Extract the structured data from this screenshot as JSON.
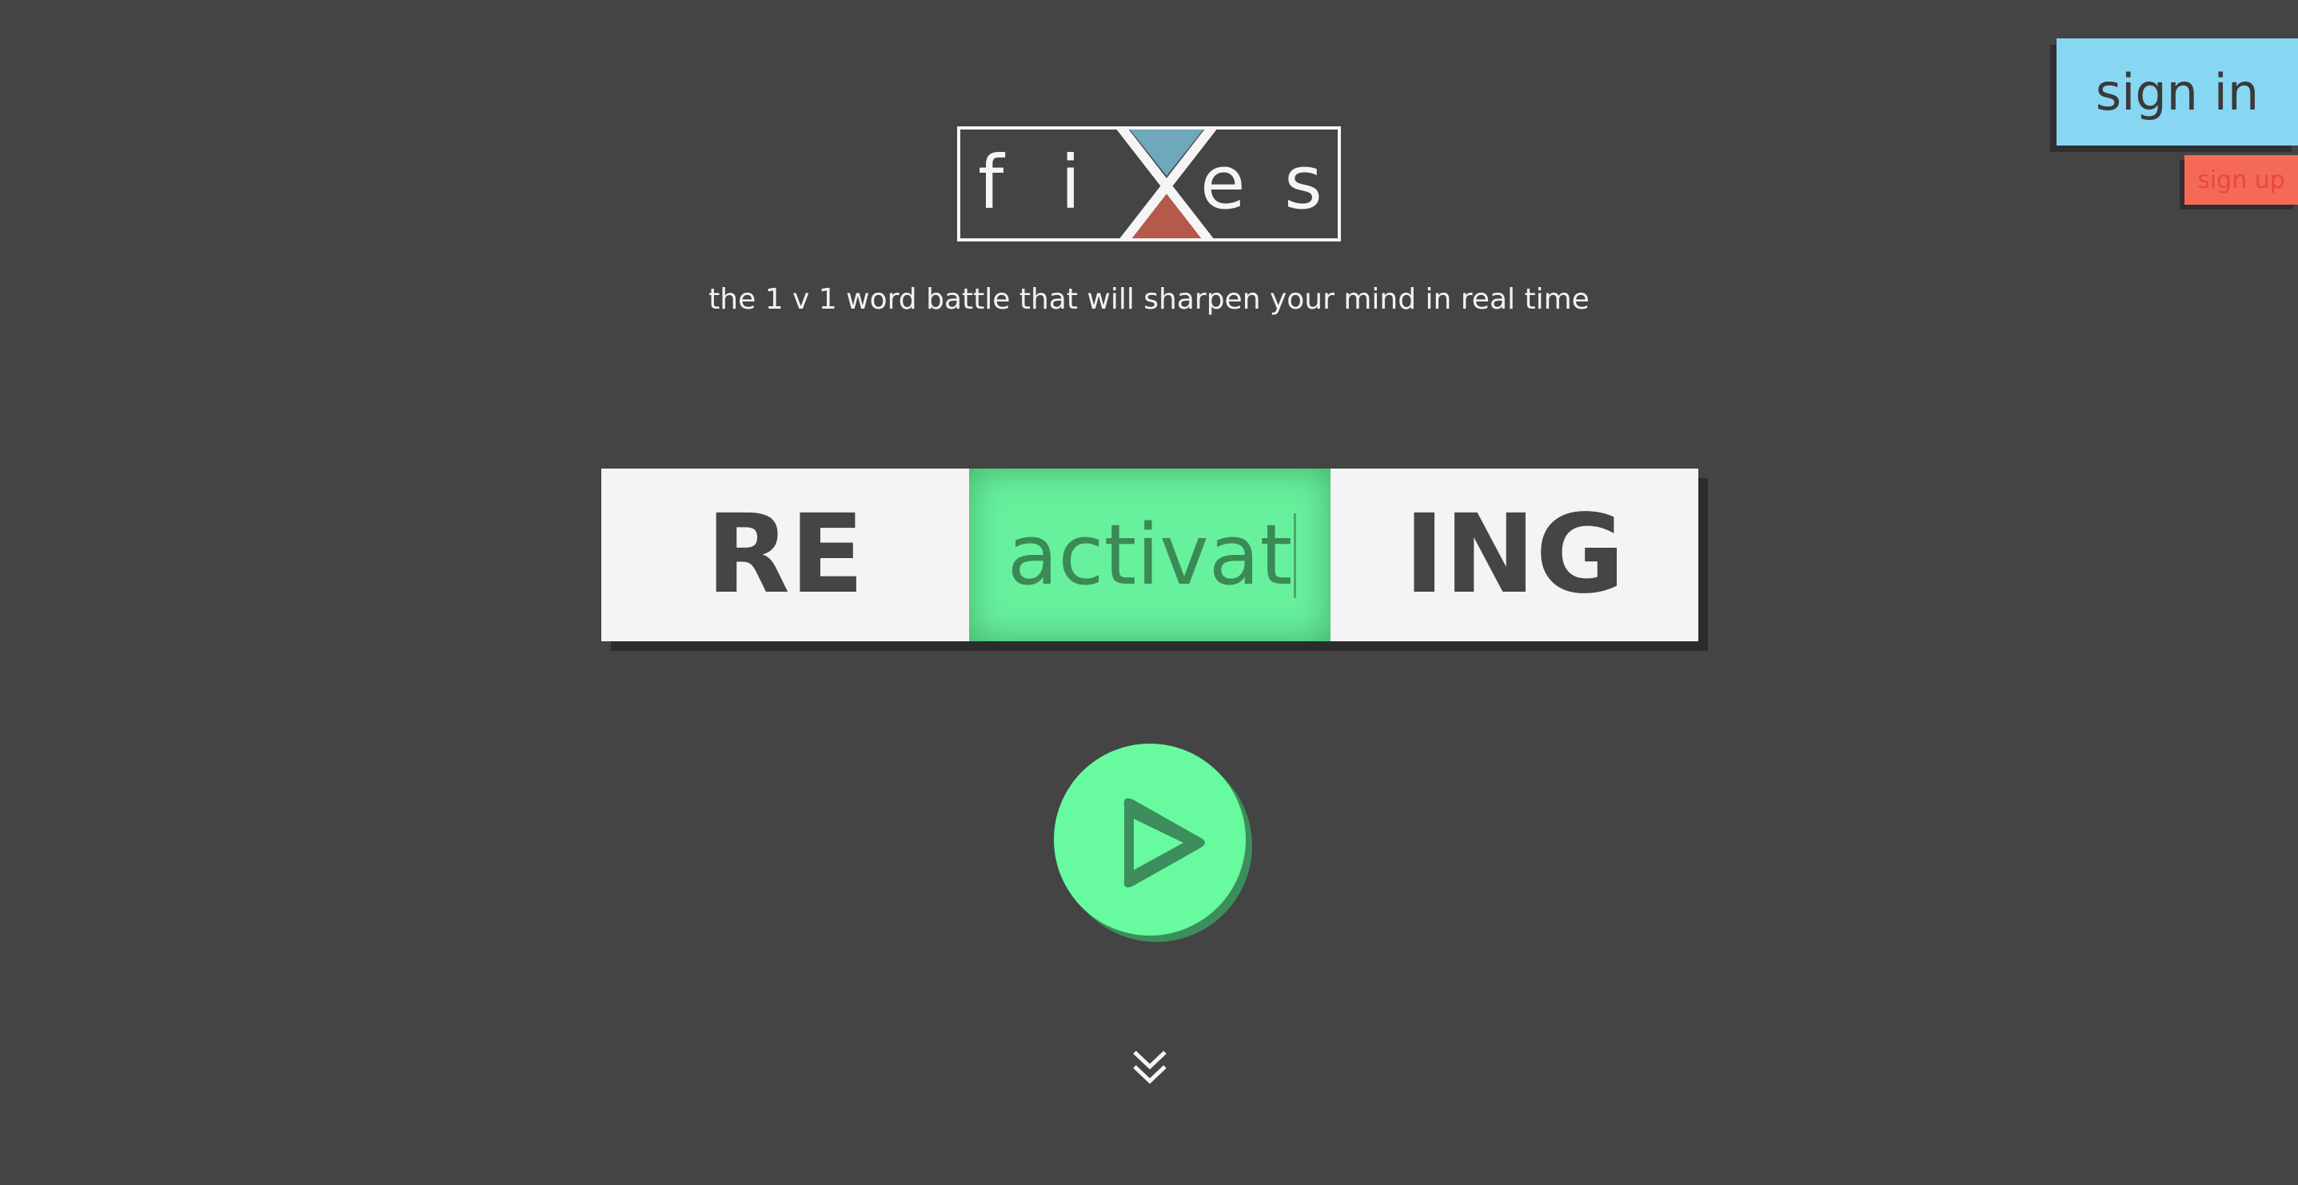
{
  "auth": {
    "sign_in_label": "sign in",
    "sign_up_label": "sign up"
  },
  "logo": {
    "letters": [
      "f",
      "i",
      "e",
      "s"
    ],
    "center_mark": "X",
    "top_triangle_color": "#6fa7bb",
    "bottom_triangle_color": "#b5594a"
  },
  "tagline": "the 1 v 1 word battle that will sharpen your mind in real time",
  "word": {
    "prefix": "RE",
    "root_input_value": "activat",
    "suffix": "ING"
  },
  "play": {
    "icon": "play-icon",
    "color": "#67fa9f"
  },
  "scroll": {
    "icon": "double-chevron-down-icon"
  },
  "colors": {
    "background": "#444444",
    "sign_in": "#87d6f2",
    "sign_up": "#f56a57",
    "accent_green": "#67f19d"
  }
}
